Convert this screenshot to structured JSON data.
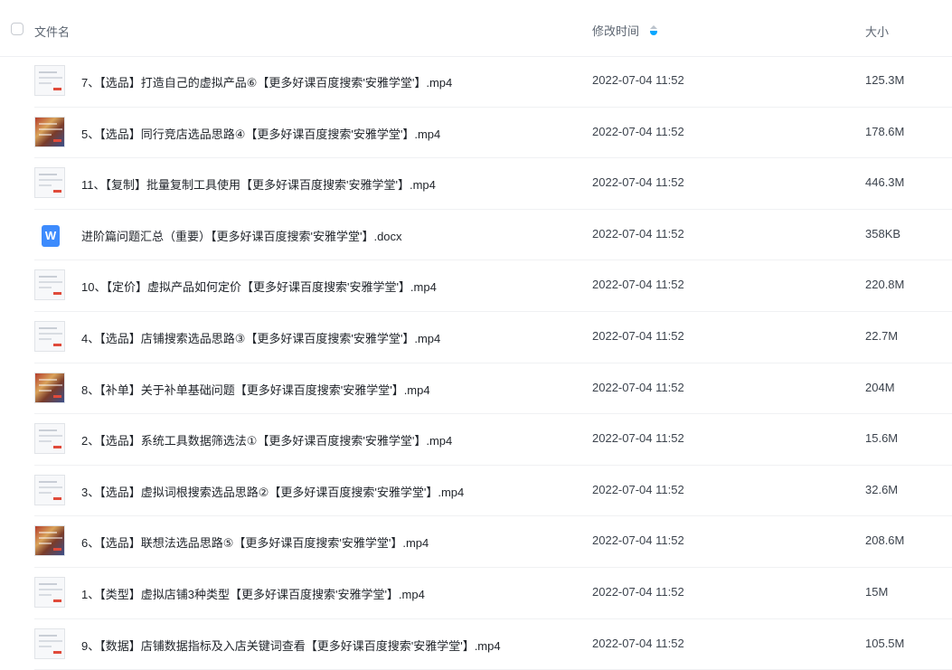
{
  "header": {
    "name_label": "文件名",
    "time_label": "修改时间",
    "size_label": "大小"
  },
  "files": [
    {
      "name": "7、【选品】打造自己的虚拟产品⑥【更多好课百度搜索'安雅学堂'】.mp4",
      "time": "2022-07-04 11:52",
      "size": "125.3M",
      "type": "video"
    },
    {
      "name": "5、【选品】同行竞店选品思路④【更多好课百度搜索'安雅学堂'】.mp4",
      "time": "2022-07-04 11:52",
      "size": "178.6M",
      "type": "video"
    },
    {
      "name": "11、【复制】批量复制工具使用【更多好课百度搜索'安雅学堂'】.mp4",
      "time": "2022-07-04 11:52",
      "size": "446.3M",
      "type": "video"
    },
    {
      "name": "进阶篇问题汇总（重要）【更多好课百度搜索'安雅学堂'】.docx",
      "time": "2022-07-04 11:52",
      "size": "358KB",
      "type": "doc"
    },
    {
      "name": "10、【定价】虚拟产品如何定价【更多好课百度搜索'安雅学堂'】.mp4",
      "time": "2022-07-04 11:52",
      "size": "220.8M",
      "type": "video"
    },
    {
      "name": "4、【选品】店铺搜索选品思路③【更多好课百度搜索'安雅学堂'】.mp4",
      "time": "2022-07-04 11:52",
      "size": "22.7M",
      "type": "video"
    },
    {
      "name": "8、【补单】关于补单基础问题【更多好课百度搜索'安雅学堂'】.mp4",
      "time": "2022-07-04 11:52",
      "size": "204M",
      "type": "video"
    },
    {
      "name": "2、【选品】系统工具数据筛选法①【更多好课百度搜索'安雅学堂'】.mp4",
      "time": "2022-07-04 11:52",
      "size": "15.6M",
      "type": "video"
    },
    {
      "name": "3、【选品】虚拟词根搜索选品思路②【更多好课百度搜索'安雅学堂'】.mp4",
      "time": "2022-07-04 11:52",
      "size": "32.6M",
      "type": "video"
    },
    {
      "name": "6、【选品】联想法选品思路⑤【更多好课百度搜索'安雅学堂'】.mp4",
      "time": "2022-07-04 11:52",
      "size": "208.6M",
      "type": "video"
    },
    {
      "name": "1、【类型】虚拟店铺3种类型【更多好课百度搜索'安雅学堂'】.mp4",
      "time": "2022-07-04 11:52",
      "size": "15M",
      "type": "video"
    },
    {
      "name": "9、【数据】店铺数据指标及入店关键词查看【更多好课百度搜索'安雅学堂'】.mp4",
      "time": "2022-07-04 11:52",
      "size": "105.5M",
      "type": "video"
    }
  ],
  "doc_icon_letter": "W",
  "colors": {
    "accent": "#06a7ff",
    "doc_icon": "#3d8bfd"
  }
}
